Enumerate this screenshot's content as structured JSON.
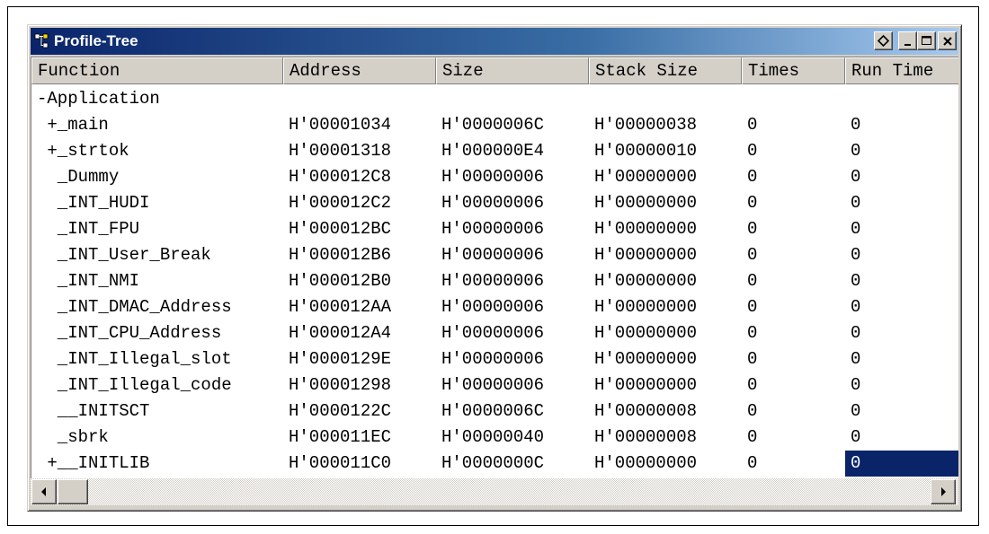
{
  "window": {
    "title": "Profile-Tree",
    "title_colors": {
      "start": "#0a246a",
      "end": "#a6caf0"
    },
    "icons": [
      "tree-icon",
      "restore-pin-icon",
      "minimize-icon",
      "maximize-icon",
      "close-icon"
    ]
  },
  "table": {
    "columns": [
      "Function",
      "Address",
      "Size",
      "Stack Size",
      "Times",
      "Run Time"
    ],
    "rows": [
      [
        "-Application",
        "",
        "",
        "",
        "",
        ""
      ],
      [
        " +_main",
        "H'00001034",
        "H'0000006C",
        "H'00000038",
        "0",
        "0"
      ],
      [
        " +_strtok",
        "H'00001318",
        "H'000000E4",
        "H'00000010",
        "0",
        "0"
      ],
      [
        "  _Dummy",
        "H'000012C8",
        "H'00000006",
        "H'00000000",
        "0",
        "0"
      ],
      [
        "  _INT_HUDI",
        "H'000012C2",
        "H'00000006",
        "H'00000000",
        "0",
        "0"
      ],
      [
        "  _INT_FPU",
        "H'000012BC",
        "H'00000006",
        "H'00000000",
        "0",
        "0"
      ],
      [
        "  _INT_User_Break",
        "H'000012B6",
        "H'00000006",
        "H'00000000",
        "0",
        "0"
      ],
      [
        "  _INT_NMI",
        "H'000012B0",
        "H'00000006",
        "H'00000000",
        "0",
        "0"
      ],
      [
        "  _INT_DMAC_Address",
        "H'000012AA",
        "H'00000006",
        "H'00000000",
        "0",
        "0"
      ],
      [
        "  _INT_CPU_Address",
        "H'000012A4",
        "H'00000006",
        "H'00000000",
        "0",
        "0"
      ],
      [
        "  _INT_Illegal_slot",
        "H'0000129E",
        "H'00000006",
        "H'00000000",
        "0",
        "0"
      ],
      [
        "  _INT_Illegal_code",
        "H'00001298",
        "H'00000006",
        "H'00000000",
        "0",
        "0"
      ],
      [
        "  __INITSCT",
        "H'0000122C",
        "H'0000006C",
        "H'00000008",
        "0",
        "0"
      ],
      [
        "  _sbrk",
        "H'000011EC",
        "H'00000040",
        "H'00000008",
        "0",
        "0"
      ],
      [
        " +__INITLIB",
        "H'000011C0",
        "H'0000000C",
        "H'00000000",
        "0",
        "0"
      ]
    ],
    "selected_cell": {
      "row": 14,
      "col": 5
    },
    "selection_color": "#0a246a"
  },
  "scrollbar": {
    "left_icon": "scroll-left-arrow-icon",
    "right_icon": "scroll-right-arrow-icon"
  }
}
